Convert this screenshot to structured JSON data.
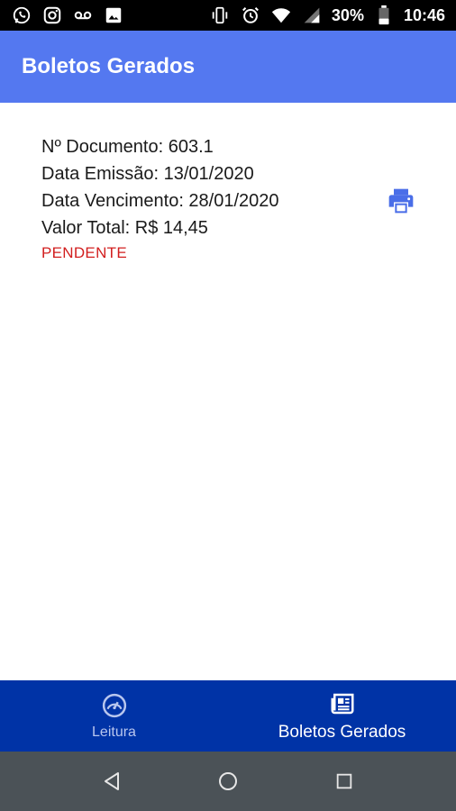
{
  "status_bar": {
    "battery_percent": "30%",
    "time": "10:46",
    "left_icons": [
      "whatsapp-icon",
      "instagram-icon",
      "voicemail-icon",
      "image-icon"
    ],
    "right_icons": [
      "vibrate-icon",
      "alarm-icon",
      "wifi-icon",
      "signal-icon",
      "battery-icon"
    ]
  },
  "app_bar": {
    "title": "Boletos Gerados",
    "color": "#5478f0"
  },
  "boleto": {
    "documento": "Nº Documento: 603.1",
    "emissao": "Data Emissão: 13/01/2020",
    "vencimento": "Data Vencimento: 28/01/2020",
    "valor": "Valor Total: R$ 14,45",
    "status": "PENDENTE",
    "status_color": "#d21e1e",
    "action_icon": "print-icon"
  },
  "bottom_nav": {
    "color": "#0033a6",
    "items": [
      {
        "label": "Leitura",
        "icon": "speedometer-icon",
        "active": false
      },
      {
        "label": "Boletos Gerados",
        "icon": "newspaper-icon",
        "active": true
      }
    ]
  },
  "system_nav": {
    "buttons": [
      "back-icon",
      "home-icon",
      "recents-icon"
    ]
  }
}
